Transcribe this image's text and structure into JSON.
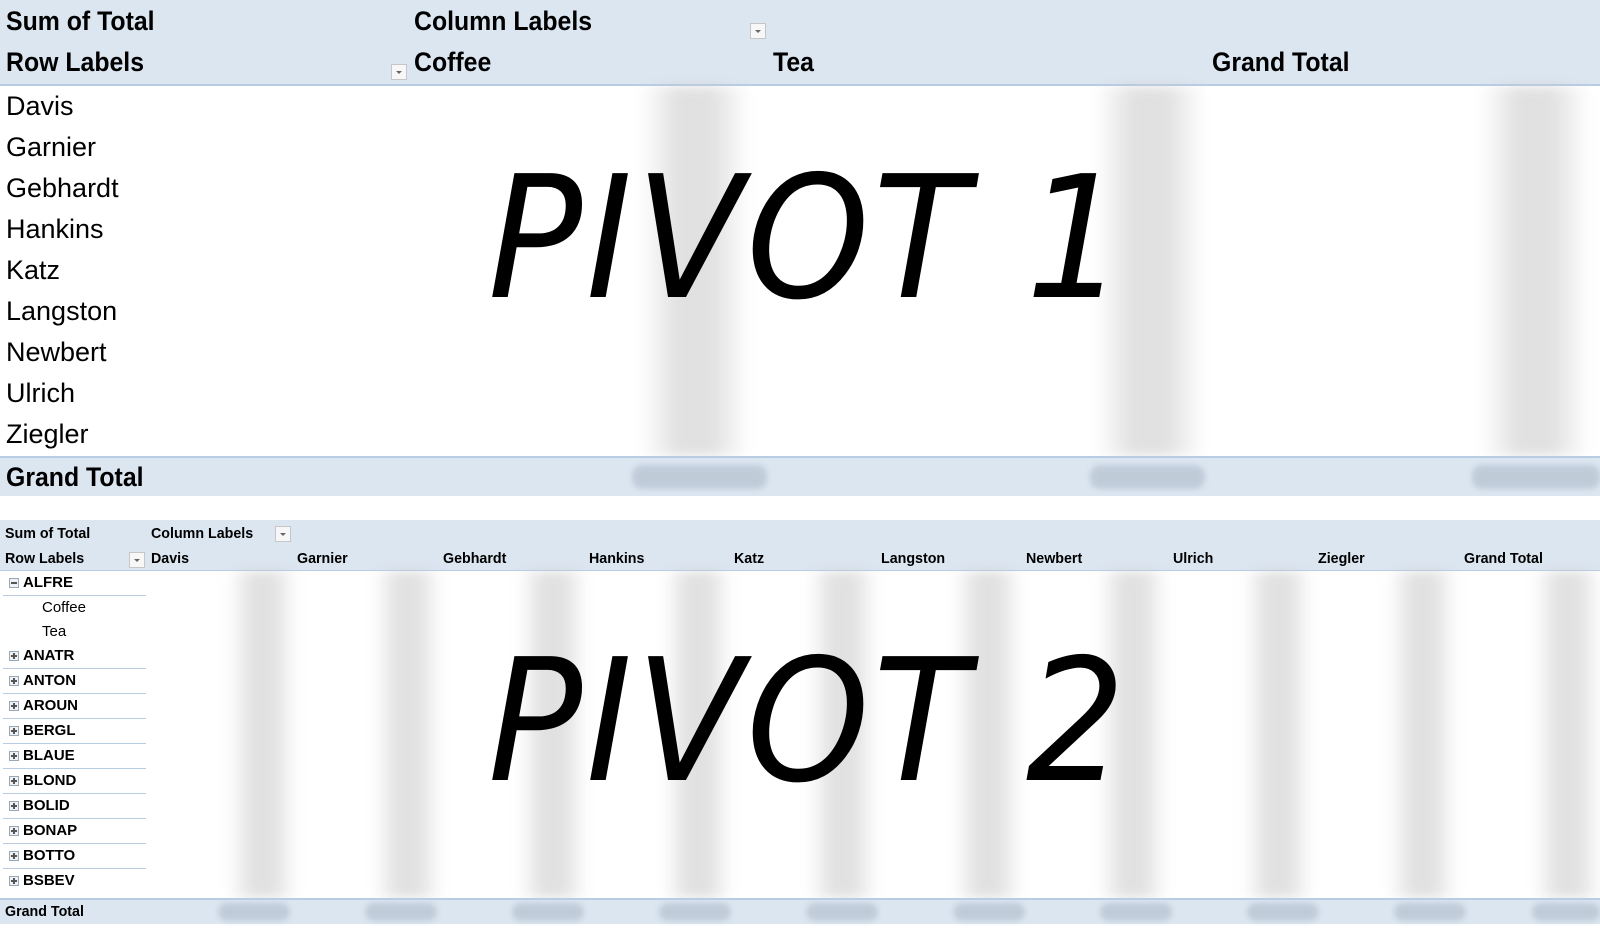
{
  "pivot1": {
    "value_field": "Sum of Total",
    "column_labels": "Column Labels",
    "row_labels": "Row Labels",
    "columns": [
      "Coffee",
      "Tea",
      "Grand Total"
    ],
    "rows": [
      "Davis",
      "Garnier",
      "Gebhardt",
      "Hankins",
      "Katz",
      "Langston",
      "Newbert",
      "Ulrich",
      "Ziegler"
    ],
    "grand_total_label": "Grand Total",
    "overlay_text": "PIVOT 1",
    "values_obscured": true
  },
  "pivot2": {
    "value_field": "Sum of Total",
    "column_labels": "Column Labels",
    "row_labels": "Row Labels",
    "columns": [
      "Davis",
      "Garnier",
      "Gebhardt",
      "Hankins",
      "Katz",
      "Langston",
      "Newbert",
      "Ulrich",
      "Ziegler",
      "Grand Total"
    ],
    "rows": [
      {
        "label": "ALFRE",
        "expanded": true,
        "children": [
          "Coffee",
          "Tea"
        ]
      },
      {
        "label": "ANATR",
        "expanded": false
      },
      {
        "label": "ANTON",
        "expanded": false
      },
      {
        "label": "AROUN",
        "expanded": false
      },
      {
        "label": "BERGL",
        "expanded": false
      },
      {
        "label": "BLAUE",
        "expanded": false
      },
      {
        "label": "BLOND",
        "expanded": false
      },
      {
        "label": "BOLID",
        "expanded": false
      },
      {
        "label": "BONAP",
        "expanded": false
      },
      {
        "label": "BOTTO",
        "expanded": false
      },
      {
        "label": "BSBEV",
        "expanded": false
      }
    ],
    "grand_total_label": "Grand Total",
    "overlay_text": "PIVOT 2",
    "values_obscured": true
  },
  "colors": {
    "header_bg": "#dce6f1",
    "header_border": "#b8cce4"
  }
}
